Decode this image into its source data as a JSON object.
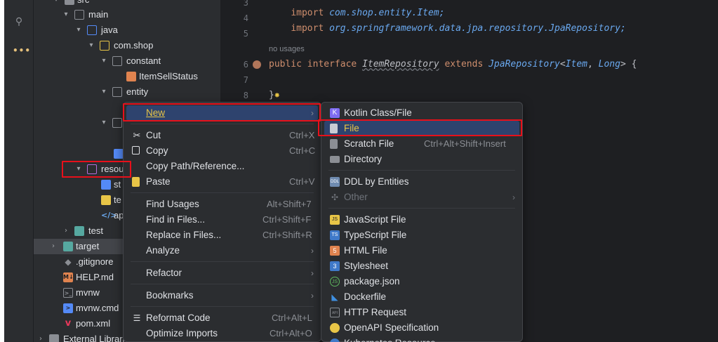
{
  "project_tree": {
    "rows": [
      {
        "label": "src",
        "indent": 90
      },
      {
        "label": "main",
        "indent": 110
      },
      {
        "label": "java",
        "indent": 128
      },
      {
        "label": "com.shop",
        "indent": 146
      },
      {
        "label": "constant",
        "indent": 164
      },
      {
        "label": "ItemSellStatus",
        "indent": 182
      },
      {
        "label": "entity",
        "indent": 164
      },
      {
        "label": "resources",
        "indent": 128
      },
      {
        "label": "st",
        "indent": 146
      },
      {
        "label": "te",
        "indent": 146
      },
      {
        "label": "ap",
        "indent": 146
      },
      {
        "label": "test",
        "indent": 110
      },
      {
        "label": "target",
        "indent": 92
      },
      {
        "label": ".gitignore",
        "indent": 92
      },
      {
        "label": "HELP.md",
        "indent": 92
      },
      {
        "label": "mvnw",
        "indent": 92
      },
      {
        "label": "mvnw.cmd",
        "indent": 92
      },
      {
        "label": "pom.xml",
        "indent": 92
      },
      {
        "label": "External Libraries",
        "indent": 72
      }
    ]
  },
  "editor": {
    "line_numbers": [
      "3",
      "4",
      "5",
      "6",
      "7",
      "8"
    ],
    "import1_kw": "import",
    "import1_path": "com.shop.entity.Item;",
    "import2_kw": "import",
    "import2_path": "org.springframework.data.jpa.repository.JpaRepository;",
    "inlay": "no usages",
    "decl_public": "public",
    "decl_interface": "interface",
    "decl_name": "ItemRepository",
    "decl_extends": "extends",
    "decl_type": "JpaRepository",
    "decl_lt": "<",
    "decl_item": "Item",
    "decl_comma": ", ",
    "decl_long": "Long",
    "decl_gt": "> {",
    "close_brace": "}"
  },
  "context_menu": {
    "items": [
      {
        "label": "New",
        "shortcut": "",
        "submenu": true
      },
      {
        "label": "Cut",
        "shortcut": "Ctrl+X"
      },
      {
        "label": "Copy",
        "shortcut": "Ctrl+C"
      },
      {
        "label": "Copy Path/Reference...",
        "shortcut": ""
      },
      {
        "label": "Paste",
        "shortcut": "Ctrl+V"
      },
      {
        "label": "Find Usages",
        "shortcut": "Alt+Shift+7"
      },
      {
        "label": "Find in Files...",
        "shortcut": "Ctrl+Shift+F"
      },
      {
        "label": "Replace in Files...",
        "shortcut": "Ctrl+Shift+R"
      },
      {
        "label": "Analyze",
        "shortcut": "",
        "submenu": true
      },
      {
        "label": "Refactor",
        "shortcut": "",
        "submenu": true
      },
      {
        "label": "Bookmarks",
        "shortcut": "",
        "submenu": true
      },
      {
        "label": "Reformat Code",
        "shortcut": "Ctrl+Alt+L"
      },
      {
        "label": "Optimize Imports",
        "shortcut": "Ctrl+Alt+O"
      }
    ]
  },
  "new_submenu": {
    "items": [
      {
        "label": "Kotlin Class/File",
        "shortcut": ""
      },
      {
        "label": "File",
        "shortcut": ""
      },
      {
        "label": "Scratch File",
        "shortcut": "Ctrl+Alt+Shift+Insert"
      },
      {
        "label": "Directory",
        "shortcut": ""
      },
      {
        "label": "DDL by Entities",
        "shortcut": ""
      },
      {
        "label": "Other",
        "shortcut": ""
      },
      {
        "label": "JavaScript File",
        "shortcut": ""
      },
      {
        "label": "TypeScript File",
        "shortcut": ""
      },
      {
        "label": "HTML File",
        "shortcut": ""
      },
      {
        "label": "Stylesheet",
        "shortcut": ""
      },
      {
        "label": "package.json",
        "shortcut": ""
      },
      {
        "label": "Dockerfile",
        "shortcut": ""
      },
      {
        "label": "HTTP Request",
        "shortcut": ""
      },
      {
        "label": "OpenAPI Specification",
        "shortcut": ""
      },
      {
        "label": "Kubernetes Resource",
        "shortcut": ""
      }
    ]
  },
  "colors": {
    "highlight_box": "#e8101a",
    "menu_hover": "#2e436e",
    "folder_blue": "#548af7",
    "resources_purple": "#b46fdb"
  }
}
